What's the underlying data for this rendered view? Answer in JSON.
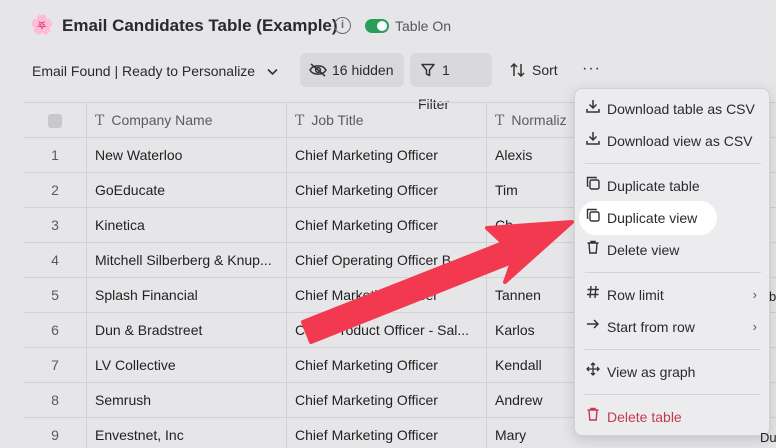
{
  "header": {
    "emoji": "🌸",
    "title": "Email Candidates Table (Example)",
    "info_glyph": "i",
    "toggle_label": "Table On"
  },
  "toolbar": {
    "view": "Email Found | Ready to Personalize",
    "hidden_label": "16 hidden",
    "filter_label": "1 Filter",
    "sort_label": "Sort",
    "more_glyph": "···"
  },
  "table": {
    "columns": [
      "Company Name",
      "Job Title",
      "Normaliz"
    ],
    "rows": [
      {
        "n": "1",
        "company": "New Waterloo",
        "title": "Chief Marketing Officer",
        "name": "Alexis"
      },
      {
        "n": "2",
        "company": "GoEducate",
        "title": "Chief Marketing Officer",
        "name": "Tim"
      },
      {
        "n": "3",
        "company": "Kinetica",
        "title": "Chief Marketing Officer",
        "name": "Ch"
      },
      {
        "n": "4",
        "company": "Mitchell Silberberg & Knup...",
        "title": "Chief Operating Officer B",
        "name": ""
      },
      {
        "n": "5",
        "company": "Splash Financial",
        "title": "Chief Marketing Officer",
        "name": "Tannen"
      },
      {
        "n": "6",
        "company": "Dun & Bradstreet",
        "title": "Chief Product Officer - Sal...",
        "name": "Karlos"
      },
      {
        "n": "7",
        "company": "LV Collective",
        "title": "Chief Marketing Officer",
        "name": "Kendall"
      },
      {
        "n": "8",
        "company": "Semrush",
        "title": "Chief Marketing Officer",
        "name": "Andrew"
      },
      {
        "n": "9",
        "company": "Envestnet, Inc",
        "title": "Chief Marketing Officer",
        "name": "Mary"
      }
    ],
    "peek_texts": [
      "b",
      "Dugan"
    ]
  },
  "menu": {
    "items": [
      {
        "label": "Download table as CSV",
        "icon": "download-icon"
      },
      {
        "label": "Download view as CSV",
        "icon": "download-icon"
      },
      {
        "label": "Duplicate table",
        "icon": "copy-icon"
      },
      {
        "label": "Duplicate view",
        "icon": "copy-icon"
      },
      {
        "label": "Delete view",
        "icon": "trash-icon"
      },
      {
        "label": "Row limit",
        "icon": "hash-icon"
      },
      {
        "label": "Start from row",
        "icon": "arrow-right-icon"
      },
      {
        "label": "View as graph",
        "icon": "move-icon"
      },
      {
        "label": "Delete table",
        "icon": "trash-icon"
      }
    ]
  },
  "colors": {
    "accent_toggle": "#2a9d5c",
    "danger": "#c43a4d",
    "annotation_arrow": "#f2394f"
  }
}
